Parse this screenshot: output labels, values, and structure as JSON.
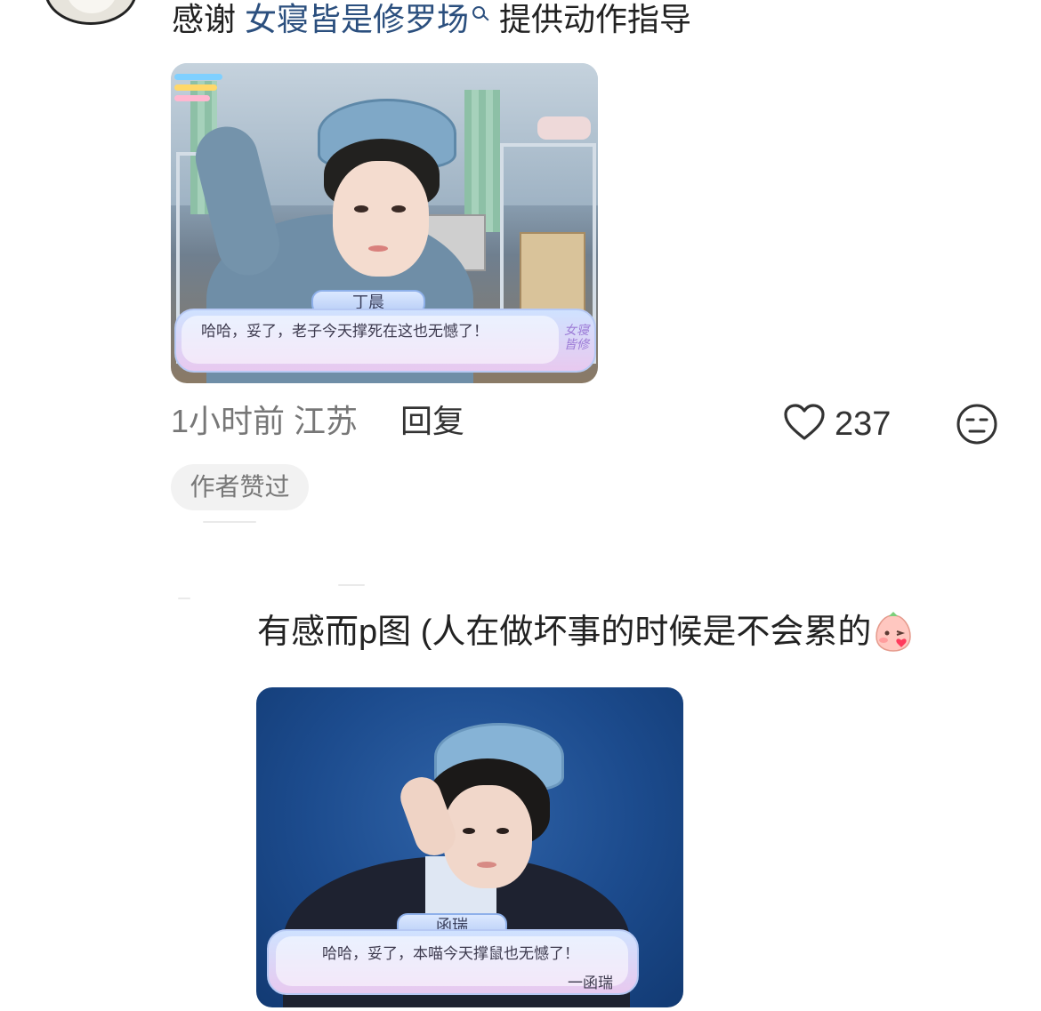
{
  "comment1": {
    "prefix": "感谢 ",
    "mention": "女寝皆是修罗场",
    "suffix": " 提供动作指导",
    "image": {
      "nameplate": "丁晨",
      "dialog": "哈哈，妥了，老子今天撑死在这也无憾了！",
      "watermark": "女寝皆修"
    },
    "time_location": "1小时前 江苏",
    "reply_label": "回复",
    "like_count": "237",
    "author_badge": "作者赞过"
  },
  "comment2": {
    "text": "有感而p图 (人在做坏事的时候是不会累的",
    "image": {
      "nameplate": "函瑞",
      "dialog": "哈哈，妥了，本喵今天撑鼠也无憾了！",
      "signature": "一函瑞"
    }
  },
  "icons": [
    "search-icon",
    "heart-icon",
    "face-icon",
    "emoji-icon"
  ],
  "colors": {
    "mention": "#2b4f7e",
    "text": "#222222",
    "meta": "#777777"
  }
}
